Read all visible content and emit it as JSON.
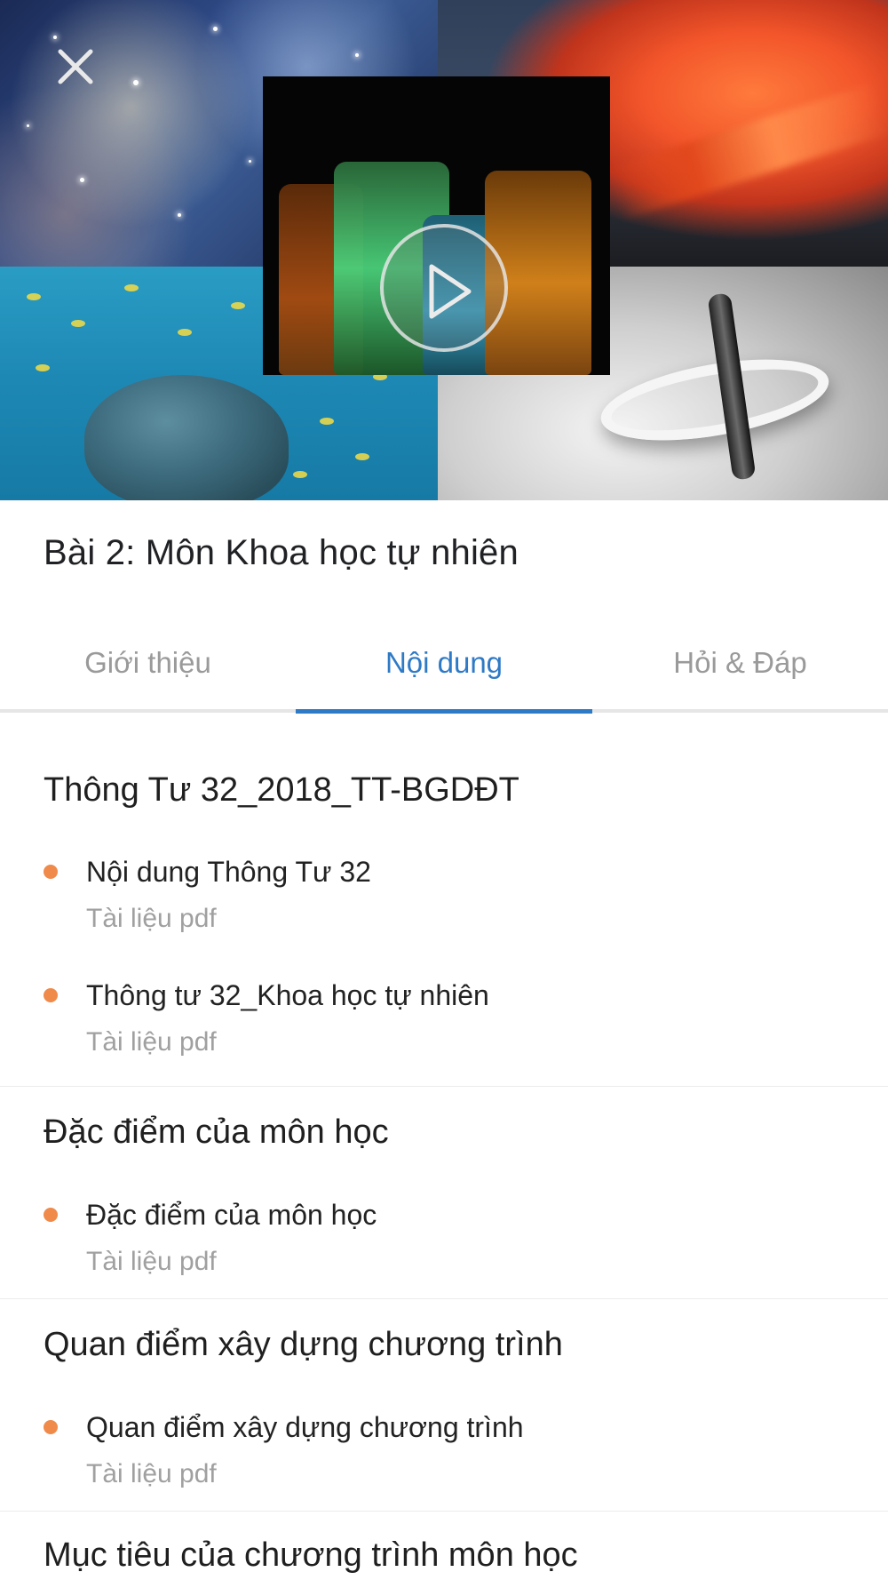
{
  "hero": {
    "close_icon": "close-icon",
    "play_icon": "play-icon",
    "colors": {
      "overlay_stroke": "#ebebeb"
    }
  },
  "lesson": {
    "title": "Bài 2: Môn Khoa học tự nhiên"
  },
  "tabs": [
    {
      "label": "Giới thiệu",
      "active": false
    },
    {
      "label": "Nội dung",
      "active": true
    },
    {
      "label": "Hỏi & Đáp",
      "active": false
    }
  ],
  "accent_color": "#2f7ac6",
  "bullet_color": "#f08a4b",
  "sections": [
    {
      "title": "Thông Tư 32_2018_TT-BGDĐT",
      "items": [
        {
          "title": "Nội dung Thông Tư 32",
          "type": "Tài liệu pdf"
        },
        {
          "title": "Thông tư 32_Khoa học tự nhiên",
          "type": "Tài liệu pdf"
        }
      ]
    },
    {
      "title": "Đặc điểm của môn học",
      "items": [
        {
          "title": "Đặc điểm của môn học",
          "type": "Tài liệu pdf"
        }
      ]
    },
    {
      "title": "Quan điểm xây dựng chương trình",
      "items": [
        {
          "title": "Quan điểm xây dựng chương trình",
          "type": "Tài liệu pdf"
        }
      ]
    },
    {
      "title": "Mục tiêu của chương trình môn học",
      "items": []
    }
  ]
}
